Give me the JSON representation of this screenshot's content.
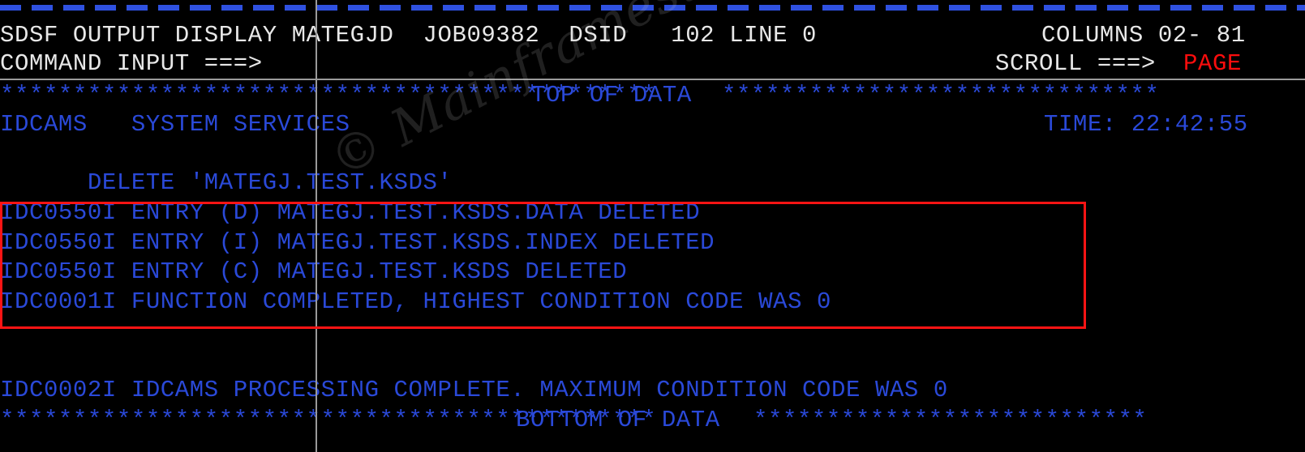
{
  "terminal": {
    "screen_width_chars": 80,
    "colors": {
      "background": "#000000",
      "header_text": "#e8e8e8",
      "body_text": "#2a49d8",
      "alert_text": "#fb0d0d",
      "highlight_box": "#fb1414",
      "rule": "#9a9a9a",
      "dash_rule": "#2f51e0"
    },
    "top_rule": "----------------------------------------------------------------------------"
  },
  "header": {
    "panel_title": "SDSF OUTPUT DISPLAY",
    "jobname": "MATEGJD",
    "jobid": "JOB09382",
    "dsid_label": "DSID",
    "dsid_value": "102",
    "line_label": "LINE",
    "line_value": "0",
    "columns_label": "COLUMNS",
    "columns_value": "02- 81",
    "title_line": "SDSF OUTPUT DISPLAY MATEGJD  JOB09382  DSID   102 LINE 0",
    "columns_line": "COLUMNS 02- 81",
    "command_label": "COMMAND INPUT ===>",
    "command_value": "",
    "scroll_label": "SCROLL ===>",
    "scroll_value": "PAGE"
  },
  "output": {
    "top_of_data": {
      "left_stars": "*********************************************",
      "label": "TOP OF DATA",
      "right_stars": "******************************"
    },
    "bottom_of_data": {
      "left_stars": "*********************************************",
      "label": "BOTTOM OF DATA",
      "right_stars": "***************************"
    },
    "lines": [
      {
        "id": "idcams-header",
        "text": "IDCAMS   SYSTEM SERVICES"
      },
      {
        "id": "idcams-time",
        "text": "TIME: 22:42:55"
      },
      {
        "id": "delete-command",
        "text": "      DELETE 'MATEGJ.TEST.KSDS'"
      },
      {
        "id": "msg-data",
        "text": "IDC0550I ENTRY (D) MATEGJ.TEST.KSDS.DATA DELETED"
      },
      {
        "id": "msg-index",
        "text": "IDC0550I ENTRY (I) MATEGJ.TEST.KSDS.INDEX DELETED"
      },
      {
        "id": "msg-cluster",
        "text": "IDC0550I ENTRY (C) MATEGJ.TEST.KSDS DELETED"
      },
      {
        "id": "msg-function",
        "text": "IDC0001I FUNCTION COMPLETED, HIGHEST CONDITION CODE WAS 0"
      },
      {
        "id": "msg-processing",
        "text": "IDC0002I IDCAMS PROCESSING COMPLETE. MAXIMUM CONDITION CODE WAS 0"
      }
    ],
    "time_label": "TIME: 22:42:55",
    "highlight_note": "IDC0550I / IDC0001I messages outlined in red"
  },
  "watermark": {
    "text": "© Mainframestechhelp"
  }
}
